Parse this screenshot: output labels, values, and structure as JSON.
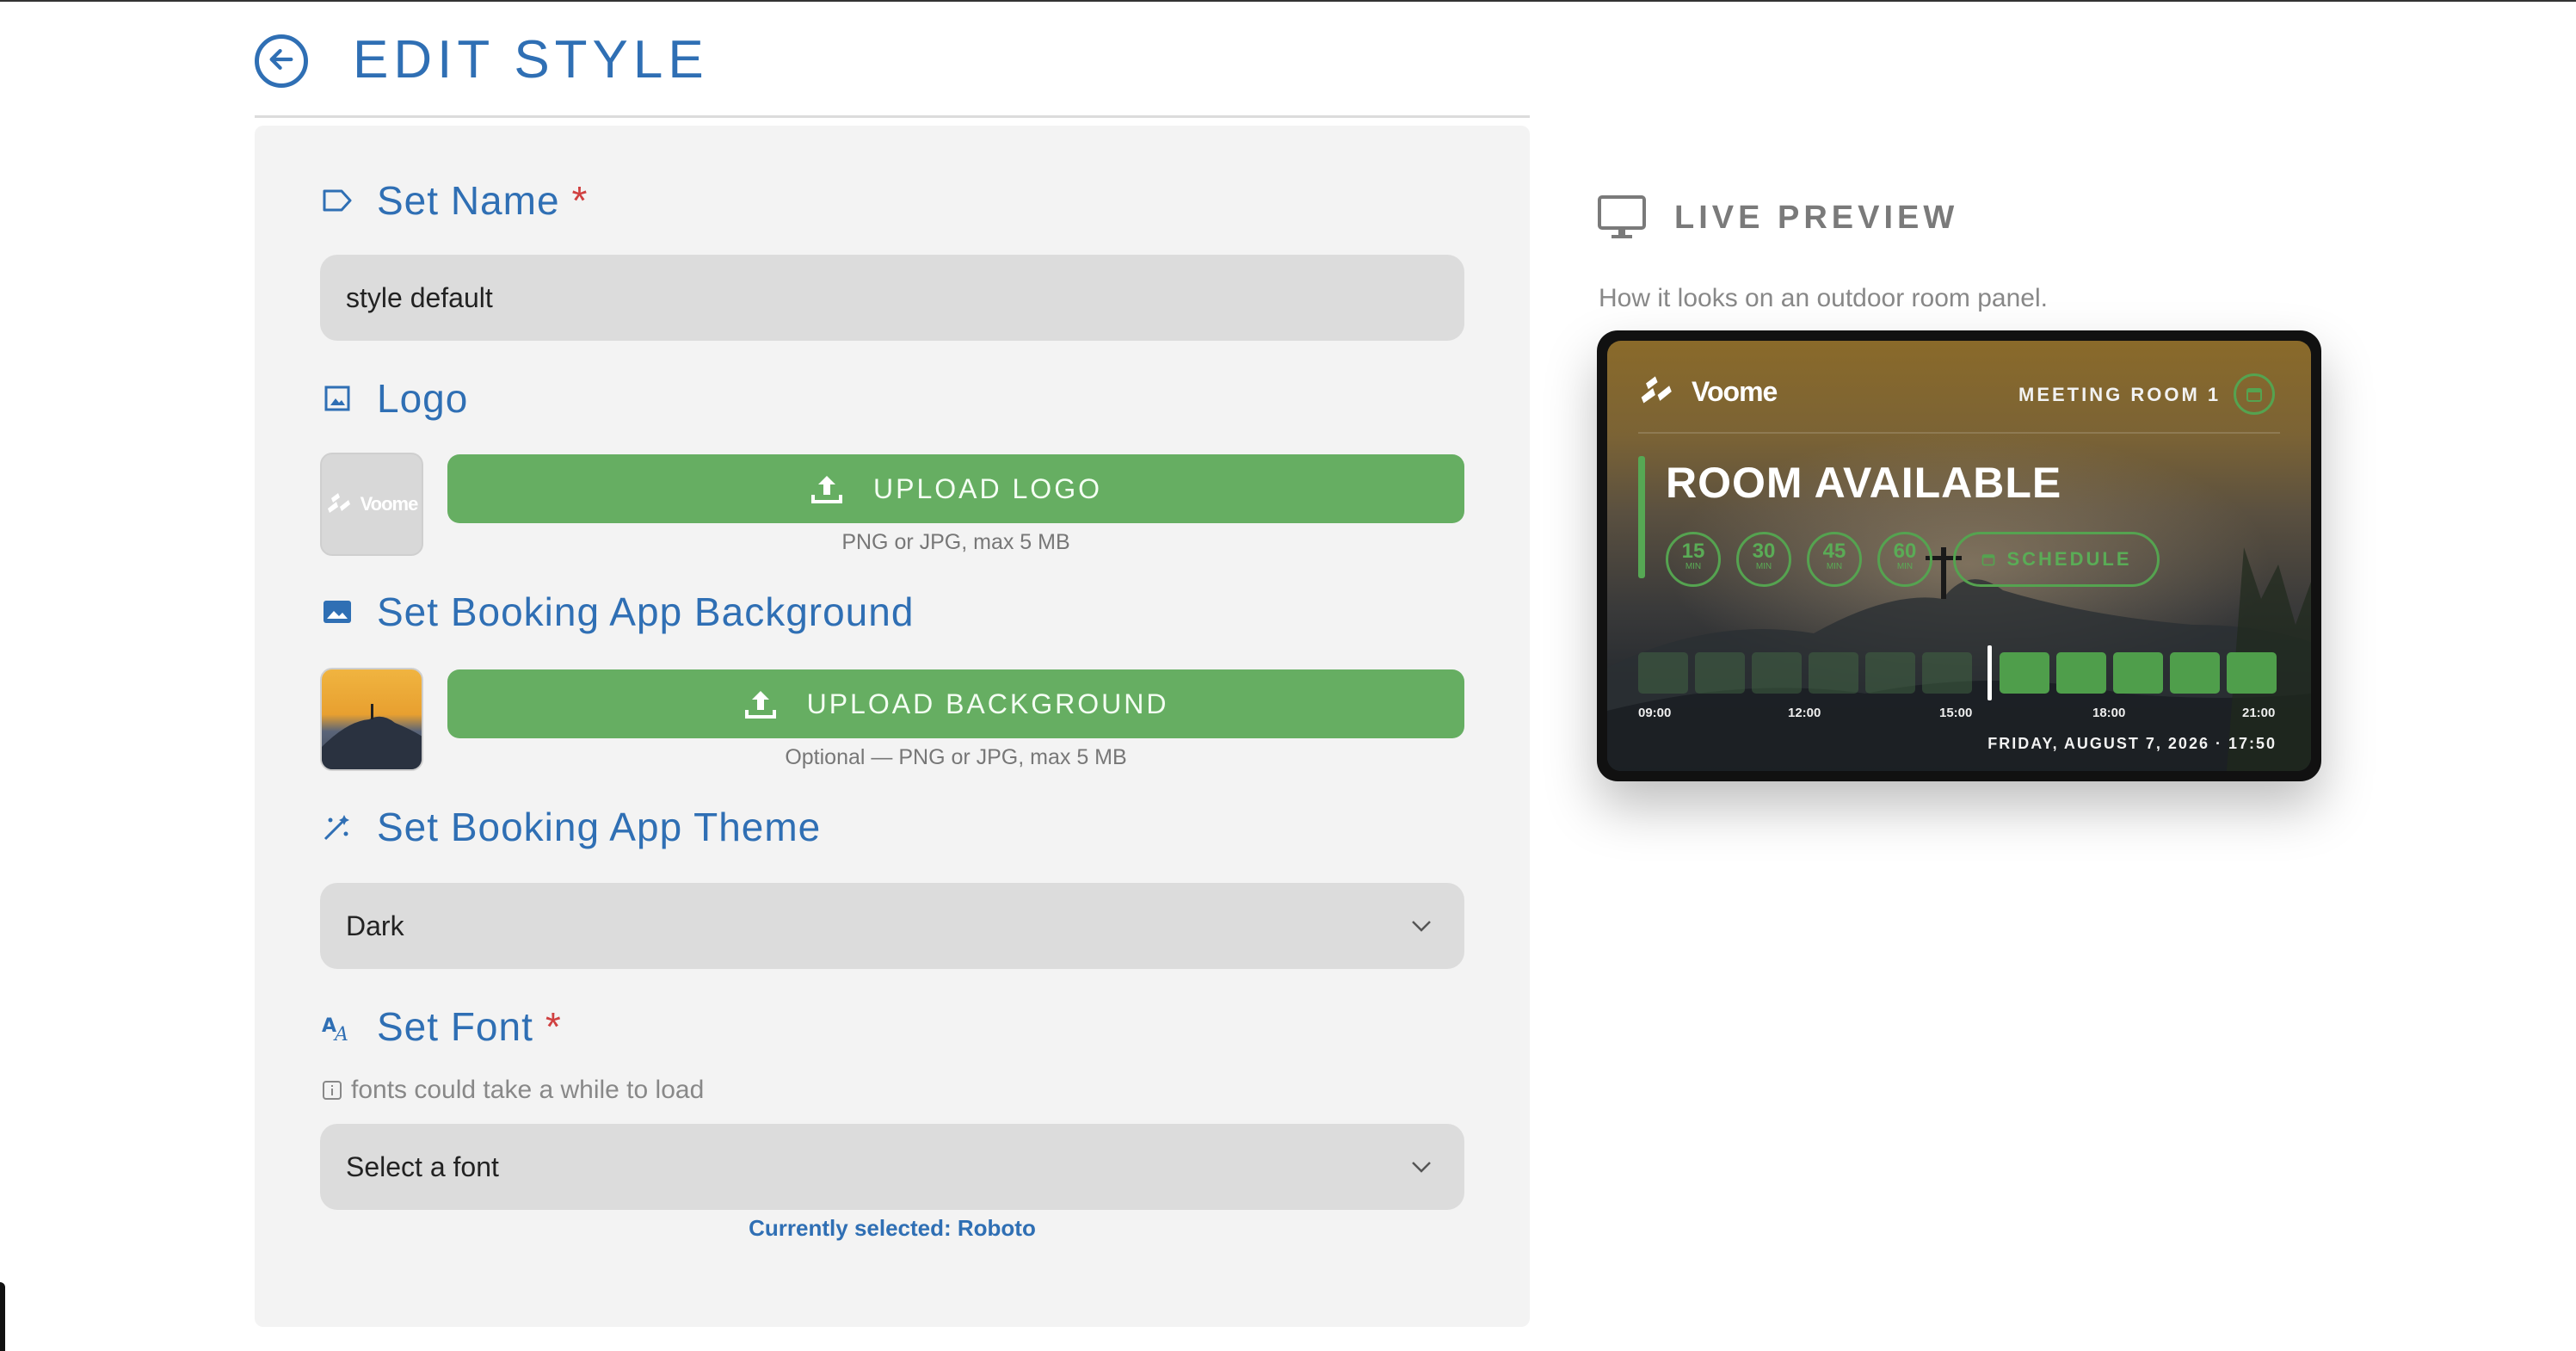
{
  "header": {
    "title": "EDIT STYLE"
  },
  "form": {
    "set_name": {
      "label": "Set Name",
      "required_mark": "*",
      "value": "style default"
    },
    "logo": {
      "label": "Logo",
      "button_label": "UPLOAD LOGO",
      "hint": "PNG or JPG, max 5 MB",
      "thumb_text": "Voome"
    },
    "background": {
      "label": "Set Booking App Background",
      "button_label": "UPLOAD BACKGROUND",
      "hint": "Optional — PNG or JPG, max 5 MB"
    },
    "theme": {
      "label": "Set Booking App Theme",
      "selected": "Dark"
    },
    "font": {
      "label": "Set Font",
      "required_mark": "*",
      "note": "fonts could take a while to load",
      "placeholder": "Select a font",
      "current": "Currently selected: Roboto"
    }
  },
  "preview": {
    "title": "LIVE PREVIEW",
    "subtitle": "How it looks on an outdoor room panel.",
    "panel": {
      "logo_text": "Voome",
      "room_name": "MEETING ROOM 1",
      "status": "ROOM AVAILABLE",
      "durations": [
        {
          "value": "15",
          "unit": "MIN"
        },
        {
          "value": "30",
          "unit": "MIN"
        },
        {
          "value": "45",
          "unit": "MIN"
        },
        {
          "value": "60",
          "unit": "MIN"
        }
      ],
      "schedule_label": "SCHEDULE",
      "timeline_ticks": [
        "09:00",
        "12:00",
        "15:00",
        "18:00",
        "21:00"
      ],
      "datetime": "FRIDAY, AUGUST 7, 2026 · 17:50"
    }
  },
  "colors": {
    "accent_blue": "#2f6fb4",
    "upload_green": "#66ae62",
    "required_red": "#d04040",
    "field_gray": "#dcdcdc"
  },
  "icons": {
    "back": "arrow-left-circle-icon",
    "name": "tag-icon",
    "logo": "image-icon",
    "background": "landscape-image-icon",
    "theme": "theme-wand-icon",
    "font": "font-icon",
    "upload": "upload-icon",
    "chevron": "chevron-down-icon",
    "info": "info-icon",
    "monitor": "monitor-icon",
    "calendar": "calendar-icon"
  }
}
